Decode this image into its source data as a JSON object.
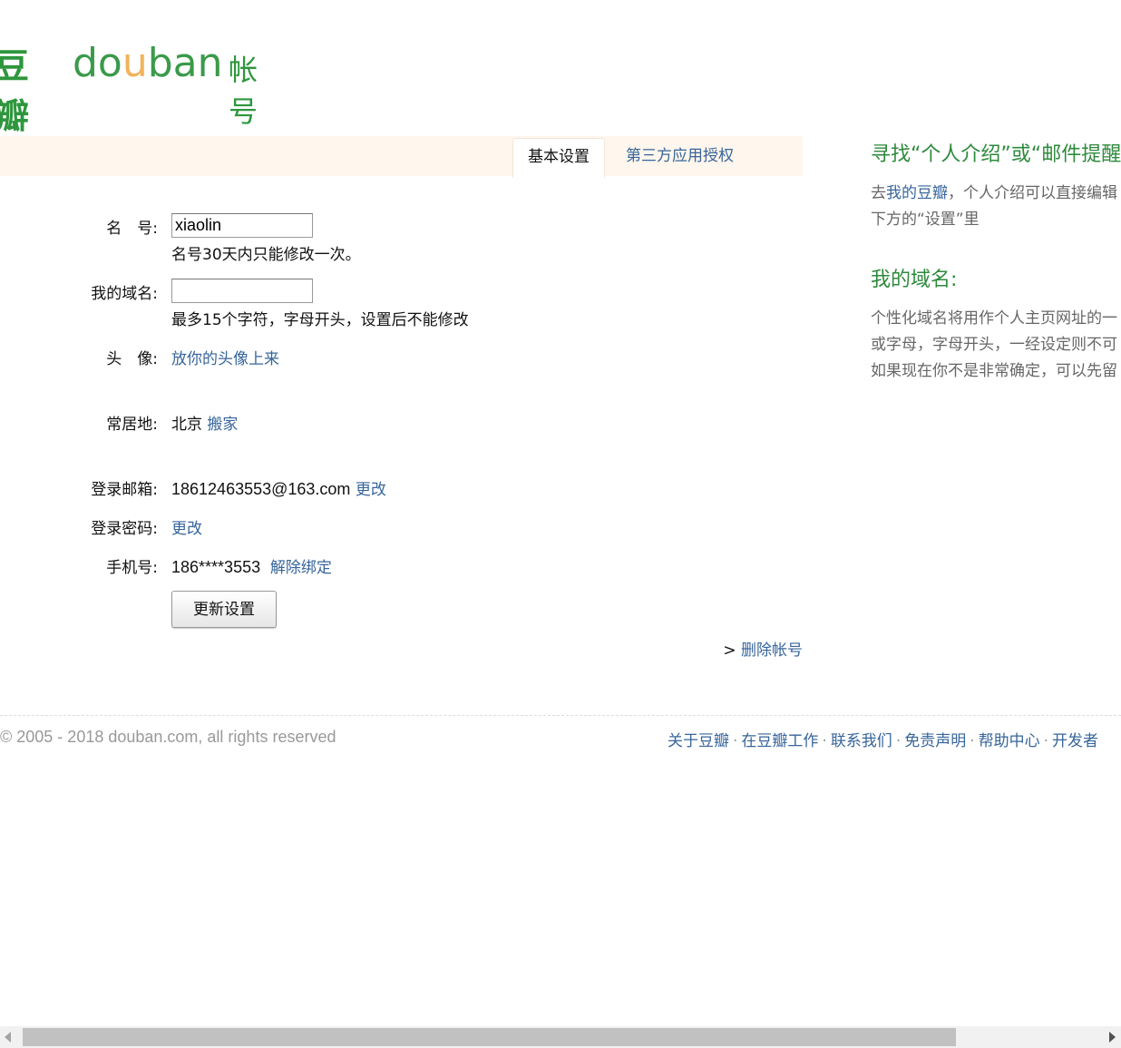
{
  "header": {
    "logo_cn": "豆瓣",
    "logo_en_1": "do",
    "logo_en_2": "u",
    "logo_en_3": "ban",
    "logo_suffix": "帐号"
  },
  "tabs": [
    {
      "label": "基本设置",
      "active": true
    },
    {
      "label": "第三方应用授权",
      "active": false
    }
  ],
  "form": {
    "name": {
      "label": "名　号:",
      "value": "xiaolin",
      "hint": "名号30天内只能修改一次。"
    },
    "domain": {
      "label": "我的域名:",
      "value": "",
      "hint": "最多15个字符，字母开头，设置后不能修改"
    },
    "avatar": {
      "label": "头　像:",
      "link": "放你的头像上来"
    },
    "city": {
      "label": "常居地:",
      "value": "北京",
      "link": "搬家"
    },
    "email": {
      "label": "登录邮箱:",
      "value": "18612463553@163.com",
      "link": "更改"
    },
    "password": {
      "label": "登录密码:",
      "link": "更改"
    },
    "phone": {
      "label": "手机号:",
      "value": "186****3553",
      "link": "解除绑定"
    },
    "submit_label": "更新设置"
  },
  "delete_account": {
    "prefix": ">",
    "link": "删除帐号"
  },
  "sidebar": {
    "heading1": "寻找“个人介绍”或“邮件提醒”",
    "p1_prefix": "去",
    "p1_link": "我的豆瓣",
    "p1_suffix": "，个人介绍可以直接编辑",
    "p1_line2": "下方的“设置”里",
    "heading2": "我的域名:",
    "p2_line1": "个性化域名将用作个人主页网址的一",
    "p2_line2": "或字母，字母开头，一经设定则不可",
    "p2_line3": "如果现在你不是非常确定，可以先留"
  },
  "footer": {
    "copyright": "© 2005 - 2018 douban.com, all rights reserved",
    "links": [
      "关于豆瓣",
      "在豆瓣工作",
      "联系我们",
      "免责声明",
      "帮助中心",
      "开发者"
    ]
  }
}
